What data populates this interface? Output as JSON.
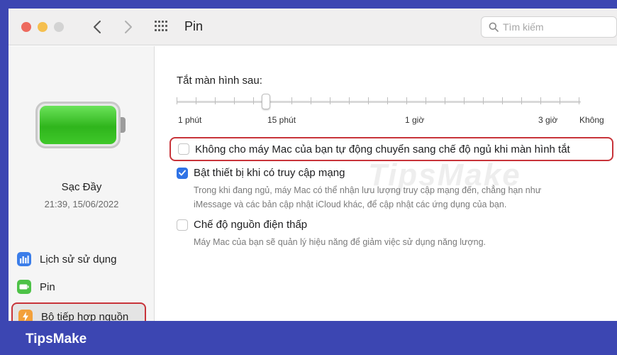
{
  "app": {
    "title": "Pin",
    "search_placeholder": "Tìm kiếm"
  },
  "sidebar": {
    "charge_status": "Sạc Đầy",
    "charge_time": "21:39, 15/06/2022",
    "battery_level_percent": 100,
    "items": [
      {
        "label": "Lịch sử sử dụng",
        "icon": "bar-chart-icon",
        "color": "#3b7de9"
      },
      {
        "label": "Pin",
        "icon": "battery-icon",
        "color": "#4dc247"
      },
      {
        "label": "Bộ tiếp hợp nguồn",
        "icon": "bolt-icon",
        "color": "#f3a03a",
        "selected": true
      }
    ]
  },
  "display_sleep": {
    "label": "Tắt màn hình sau:",
    "ticks": [
      "1 phút",
      "15 phút",
      "1 giờ",
      "3 giờ",
      "Không"
    ],
    "value": "15 phút"
  },
  "options": {
    "prevent_sleep": {
      "label": "Không cho máy Mac của bạn tự động chuyển sang chế độ ngủ khi màn hình tắt",
      "checked": false
    },
    "wake_network": {
      "label": "Bật thiết bị khi có truy cập mạng",
      "checked": true,
      "description_line1": "Trong khi đang ngủ, máy Mac có thể nhận lưu lượng truy cập mạng đến, chẳng hạn như",
      "description_line2": "iMessage và các bản cập nhật iCloud khác, để cập nhật các ứng dụng của bạn."
    },
    "low_power": {
      "label": "Chế độ nguồn điện thấp",
      "checked": false,
      "description": "Máy Mac của bạn sẽ quản lý hiệu năng để giảm việc sử dụng năng lượng."
    }
  },
  "watermark": "TipsMake",
  "brand": "TipsMake",
  "colors": {
    "frame": "#3c46b2",
    "highlight": "#c8343a",
    "accent": "#2f73e6"
  }
}
